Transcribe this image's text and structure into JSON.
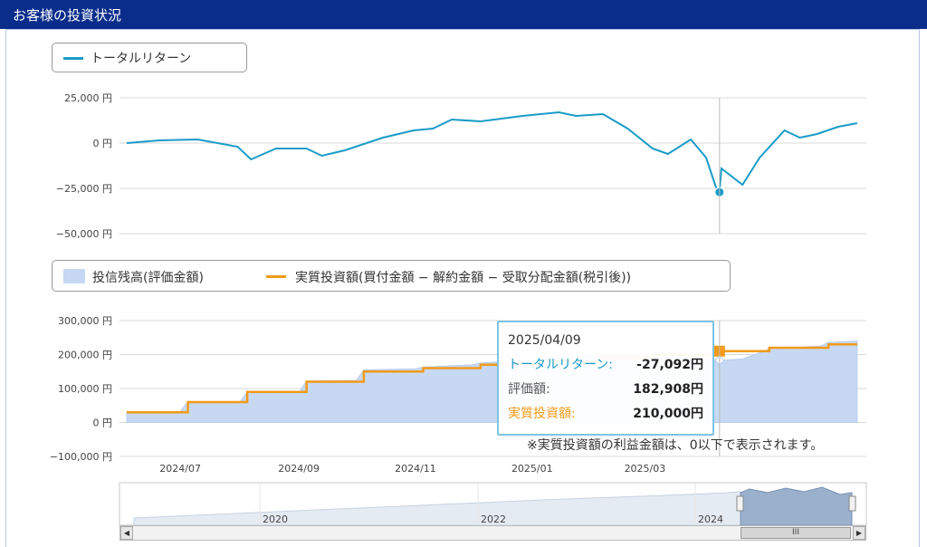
{
  "header": {
    "title": "お客様の投資状況"
  },
  "legend_top": {
    "label": "トータルリターン",
    "color": "#1a9bc8"
  },
  "legend_bottom": {
    "area_label": "投信残高(評価金額)",
    "line_label": "実質投資額(買付金額 − 解約金額 − 受取分配金額(税引後))",
    "area_color": "#c7d9f2",
    "line_color": "#f29a1a"
  },
  "tooltip": {
    "date": "2025/04/09",
    "rows": [
      {
        "label": "トータルリターン:",
        "value": "-27,092円",
        "color": "#1a9bc8"
      },
      {
        "label": "評価額:",
        "value": "182,908円",
        "color": "#555555"
      },
      {
        "label": "実質投資額:",
        "value": "210,000円",
        "color": "#f29a1a"
      }
    ]
  },
  "note": "※実質投資額の利益金額は、0以下で表示されます。",
  "navigator": {
    "ticks": [
      "2020",
      "2022",
      "2024"
    ],
    "scroll_label": "III"
  },
  "chart_data": [
    {
      "type": "line",
      "series": [
        {
          "name": "トータルリターン",
          "x": [
            "2024-06-03",
            "2024-06-20",
            "2024-07-10",
            "2024-07-31",
            "2024-08-07",
            "2024-08-20",
            "2024-09-05",
            "2024-09-13",
            "2024-09-25",
            "2024-10-15",
            "2024-10-31",
            "2024-11-10",
            "2024-11-20",
            "2024-12-05",
            "2024-12-27",
            "2025-01-15",
            "2025-01-24",
            "2025-02-07",
            "2025-02-20",
            "2025-03-05",
            "2025-03-13",
            "2025-03-25",
            "2025-04-02",
            "2025-04-07",
            "2025-04-09",
            "2025-04-10",
            "2025-04-21",
            "2025-04-30",
            "2025-05-13",
            "2025-05-21",
            "2025-05-30",
            "2025-06-10",
            "2025-06-20"
          ],
          "y": [
            0,
            1500,
            2000,
            -2000,
            -9000,
            -3000,
            -3000,
            -7000,
            -4000,
            3000,
            7000,
            8000,
            13000,
            12000,
            15000,
            17000,
            15000,
            16000,
            8000,
            -3000,
            -6000,
            2000,
            -8000,
            -24000,
            -27092,
            -14000,
            -23000,
            -8000,
            7000,
            3000,
            5000,
            9000,
            11000
          ]
        }
      ],
      "ylim": [
        -50000,
        25000
      ],
      "yticks": [
        25000,
        0,
        -25000,
        -50000
      ],
      "ytick_labels": [
        "25,000 円",
        "0 円",
        "−25,000 円",
        "−50,000 円"
      ],
      "grid": true,
      "legend": "top-left"
    },
    {
      "type": "area",
      "series": [
        {
          "name": "投信残高(評価金額)",
          "x": [
            "2024-06-03",
            "2024-07-01",
            "2024-07-05",
            "2024-08-01",
            "2024-08-05",
            "2024-09-01",
            "2024-09-05",
            "2024-10-01",
            "2024-10-05",
            "2024-11-01",
            "2024-11-05",
            "2024-12-01",
            "2024-12-05",
            "2025-01-01",
            "2025-01-05",
            "2025-02-01",
            "2025-02-05",
            "2025-03-01",
            "2025-03-05",
            "2025-04-01",
            "2025-04-09",
            "2025-04-21",
            "2025-05-01",
            "2025-05-05",
            "2025-06-01",
            "2025-06-05",
            "2025-06-20"
          ],
          "y": [
            30000,
            32000,
            62000,
            58000,
            90000,
            88000,
            122000,
            124000,
            155000,
            158000,
            163000,
            170000,
            175000,
            184000,
            187000,
            196000,
            198000,
            196000,
            191000,
            188000,
            182908,
            187000,
            207000,
            216000,
            225000,
            236000,
            240000
          ]
        },
        {
          "name": "実質投資額(買付金額 − 解約金額 − 受取分配金額(税引後))",
          "x": [
            "2024-06-03",
            "2024-07-05",
            "2024-08-05",
            "2024-09-05",
            "2024-10-05",
            "2024-11-05",
            "2024-12-05",
            "2025-01-05",
            "2025-02-05",
            "2025-03-05",
            "2025-04-05",
            "2025-05-05",
            "2025-06-05",
            "2025-06-20"
          ],
          "y": [
            30000,
            60000,
            90000,
            120000,
            150000,
            160000,
            170000,
            180000,
            190000,
            200000,
            210000,
            220000,
            230000,
            230000
          ]
        }
      ],
      "ylim": [
        -100000,
        300000
      ],
      "yticks": [
        300000,
        200000,
        100000,
        0,
        -100000
      ],
      "ytick_labels": [
        "300,000 円",
        "200,000 円",
        "100,000 円",
        "0 円",
        "−100,000 円"
      ],
      "xtick_labels": [
        "2024/07",
        "2024/09",
        "2024/11",
        "2025/01",
        "2025/03"
      ],
      "xticks": [
        "2024-07-01",
        "2024-09-01",
        "2024-11-01",
        "2025-01-01",
        "2025-03-01"
      ],
      "grid": true,
      "legend": "top-left"
    }
  ]
}
